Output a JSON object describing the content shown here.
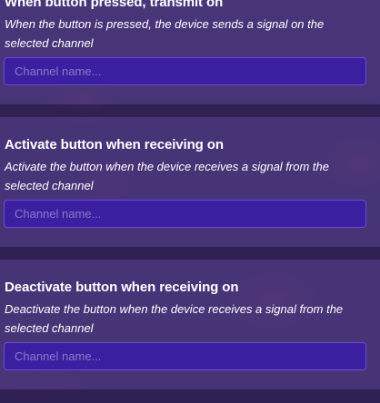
{
  "sections": [
    {
      "title": "When button pressed, transmit on",
      "description": "When the button is pressed, the device sends a signal on the selected channel",
      "input": {
        "value": "",
        "placeholder": "Channel name..."
      }
    },
    {
      "title": "Activate button when receiving on",
      "description": "Activate the button when the device receives a signal from the selected channel",
      "input": {
        "value": "",
        "placeholder": "Channel name..."
      }
    },
    {
      "title": "Deactivate button when receiving on",
      "description": "Deactivate the button when the device receives a signal from the selected channel",
      "input": {
        "value": "",
        "placeholder": "Channel name..."
      }
    }
  ]
}
